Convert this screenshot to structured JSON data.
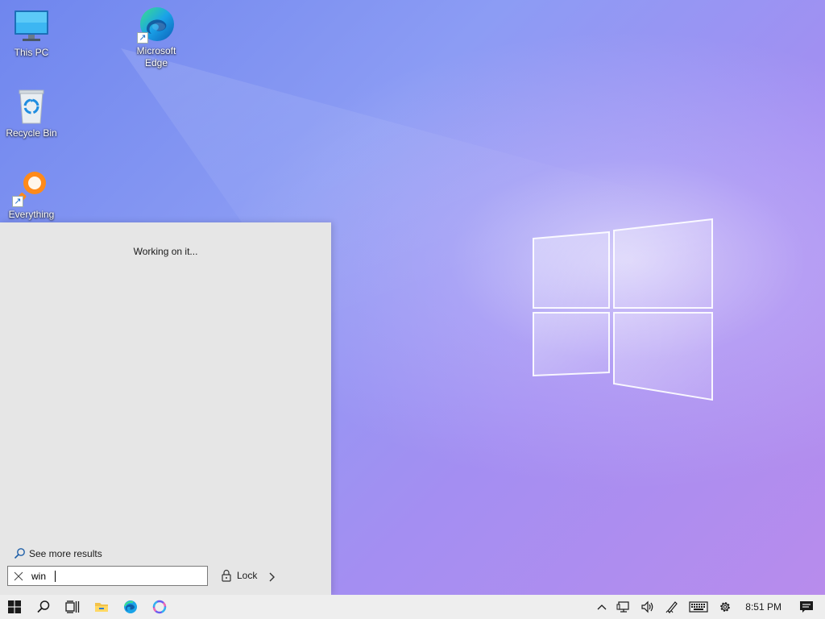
{
  "desktop": {
    "icons": [
      {
        "label": "This PC",
        "icon": "monitor-icon"
      },
      {
        "label": "Microsoft Edge",
        "icon": "edge-icon"
      },
      {
        "label": "Recycle Bin",
        "icon": "recycle-bin-icon"
      },
      {
        "label": "Everything",
        "icon": "magnifier-icon"
      }
    ]
  },
  "search_panel": {
    "status": "Working on it...",
    "see_more": "See more results",
    "query": "win",
    "lock_label": "Lock"
  },
  "taskbar": {
    "pinned": [
      "start-icon",
      "search-icon",
      "task-view-icon",
      "file-explorer-icon",
      "edge-icon",
      "copilot-icon"
    ],
    "tray_icons": [
      "chevron-up-icon",
      "network-icon",
      "volume-icon",
      "pen-icon",
      "keyboard-icon",
      "gear-icon"
    ],
    "time": "8:51 PM"
  },
  "colors": {
    "wallpaper_start": "#6f86ee",
    "wallpaper_end": "#b98cec",
    "panel": "#e6e6e6",
    "taskbar": "#eeeeee",
    "accent_blue": "#0078d4"
  }
}
